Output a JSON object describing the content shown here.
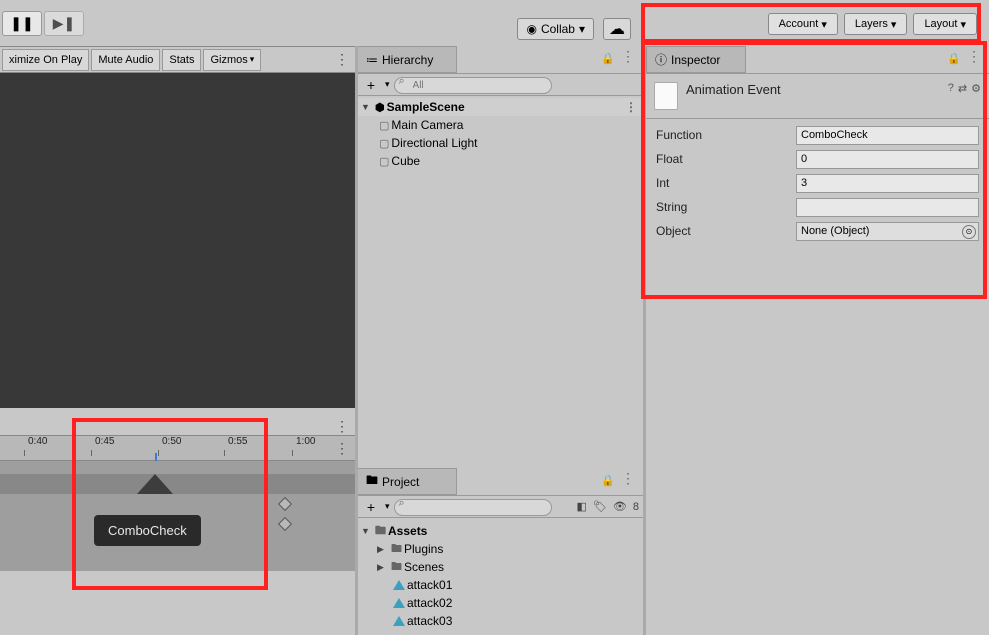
{
  "toolbar": {
    "collab_label": "Collab",
    "account_label": "Account",
    "layers_label": "Layers",
    "layout_label": "Layout"
  },
  "options": {
    "maximize": "ximize On Play",
    "mute": "Mute Audio",
    "stats": "Stats",
    "gizmos": "Gizmos"
  },
  "hierarchy": {
    "tab_label": "Hierarchy",
    "search_placeholder": "All",
    "scene": "SampleScene",
    "items": [
      "Main Camera",
      "Directional Light",
      "Cube"
    ]
  },
  "timeline": {
    "marks": [
      "0:40",
      "0:45",
      "0:50",
      "0:55",
      "1:00"
    ],
    "tooltip": "ComboCheck"
  },
  "project": {
    "tab_label": "Project",
    "hidden_count": "8",
    "root": "Assets",
    "folders": [
      "Plugins",
      "Scenes"
    ],
    "anims": [
      "attack01",
      "attack02",
      "attack03"
    ]
  },
  "inspector": {
    "tab_label": "Inspector",
    "title": "Animation Event",
    "props": {
      "function_label": "Function",
      "function_value": "ComboCheck",
      "float_label": "Float",
      "float_value": "0",
      "int_label": "Int",
      "int_value": "3",
      "string_label": "String",
      "string_value": "",
      "object_label": "Object",
      "object_value": "None (Object)"
    }
  }
}
